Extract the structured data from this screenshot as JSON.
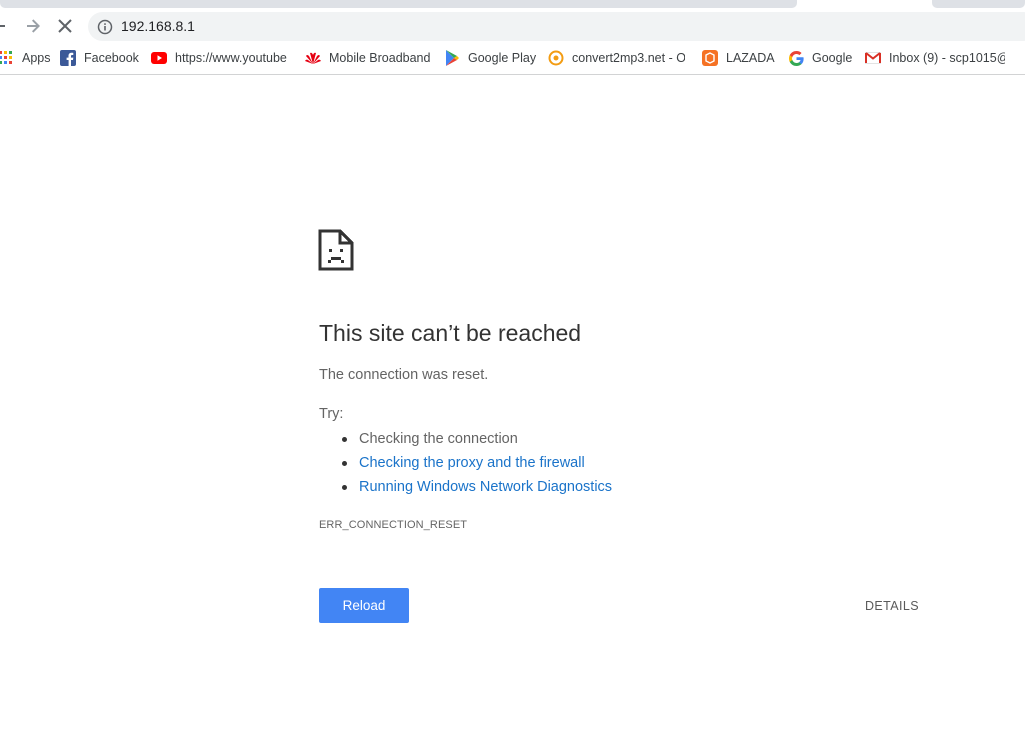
{
  "browser": {
    "address_url": "192.168.8.1"
  },
  "bookmarks": [
    {
      "label": "Apps",
      "icon": "apps-grid-icon",
      "color": "#ea4335"
    },
    {
      "label": "Facebook",
      "icon": "facebook-icon",
      "color": "#3b5998"
    },
    {
      "label": "https://www.youtube",
      "icon": "youtube-icon",
      "color": "#ff0000"
    },
    {
      "label": "Mobile Broadband",
      "icon": "huawei-icon",
      "color": "#e60012"
    },
    {
      "label": "Google Play",
      "icon": "google-play-icon",
      "color": "#34a853"
    },
    {
      "label": "convert2mp3.net - O",
      "icon": "convert2mp3-icon",
      "color": "#f39c12"
    },
    {
      "label": "LAZADA",
      "icon": "lazada-icon",
      "color": "#f57224"
    },
    {
      "label": "Google",
      "icon": "google-icon",
      "color": "#4285f4"
    },
    {
      "label": "Inbox (9) - scp1015@",
      "icon": "gmail-icon",
      "color": "#d93025"
    }
  ],
  "error": {
    "title": "This site can’t be reached",
    "summary": "The connection was reset.",
    "try_label": "Try:",
    "suggestions": [
      "Checking the connection",
      "Checking the proxy and the firewall",
      "Running Windows Network Diagnostics"
    ],
    "code": "ERR_CONNECTION_RESET",
    "reload_label": "Reload",
    "details_label": "DETAILS"
  },
  "colors": {
    "accent": "#4285f4",
    "link": "#1a73c9"
  }
}
